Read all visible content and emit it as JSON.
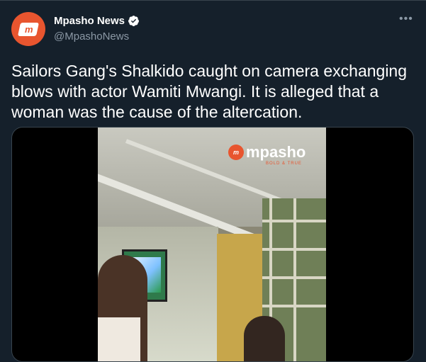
{
  "tweet": {
    "author": {
      "display_name": "Mpasho News",
      "handle": "@MpashoNews",
      "avatar_initials": "m",
      "verified": true
    },
    "more_icon": "more-options-icon",
    "text": "Sailors Gang's Shalkido caught on camera exchanging blows with actor Wamiti Mwangi. It is alleged that a woman was the cause of the altercation.",
    "media": {
      "type": "video",
      "watermark": "mpasho",
      "watermark_tagline": "BOLD & TRUE"
    }
  },
  "colors": {
    "background": "#15202b",
    "text_primary": "#ffffff",
    "text_secondary": "#8b98a5",
    "border": "#38444d",
    "brand": "#e8552f",
    "verified": "#ffffff"
  }
}
